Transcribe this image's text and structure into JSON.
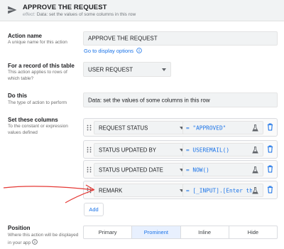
{
  "header": {
    "title": "APPROVE THE REQUEST",
    "subtitle_label": "effect:",
    "subtitle": "Data: set the values of some columns in this row"
  },
  "action_name": {
    "label": "Action name",
    "desc": "A unique name for this action",
    "value": "APPROVE THE REQUEST",
    "link": "Go to display options"
  },
  "table": {
    "label": "For a record of this table",
    "desc": "This action applies to rows of which table?",
    "value": "USER REQUEST"
  },
  "do_this": {
    "label": "Do this",
    "desc": "The type of action to perform",
    "value": "Data: set the values of some columns in this row"
  },
  "set_columns": {
    "label": "Set these columns",
    "desc": "To the constant or expression values defined",
    "rows": [
      {
        "column": "REQUEST STATUS",
        "expression": "= \"APPROVED\""
      },
      {
        "column": "STATUS UPDATED BY",
        "expression": "= USEREMAIL()"
      },
      {
        "column": "STATUS UPDATED DATE",
        "expression": "= NOW()"
      },
      {
        "column": "REMARK",
        "expression": "= [_INPUT].[Enter the"
      }
    ],
    "add_label": "Add"
  },
  "position": {
    "label": "Position",
    "desc": "Where this action will be displayed in your app",
    "options": [
      "Primary",
      "Prominent",
      "Inline",
      "Hide"
    ],
    "selected": "Prominent"
  },
  "colors": {
    "accent": "#1a73e8",
    "annotation_arrow": "#e53935",
    "trash": "#1a73e8"
  }
}
